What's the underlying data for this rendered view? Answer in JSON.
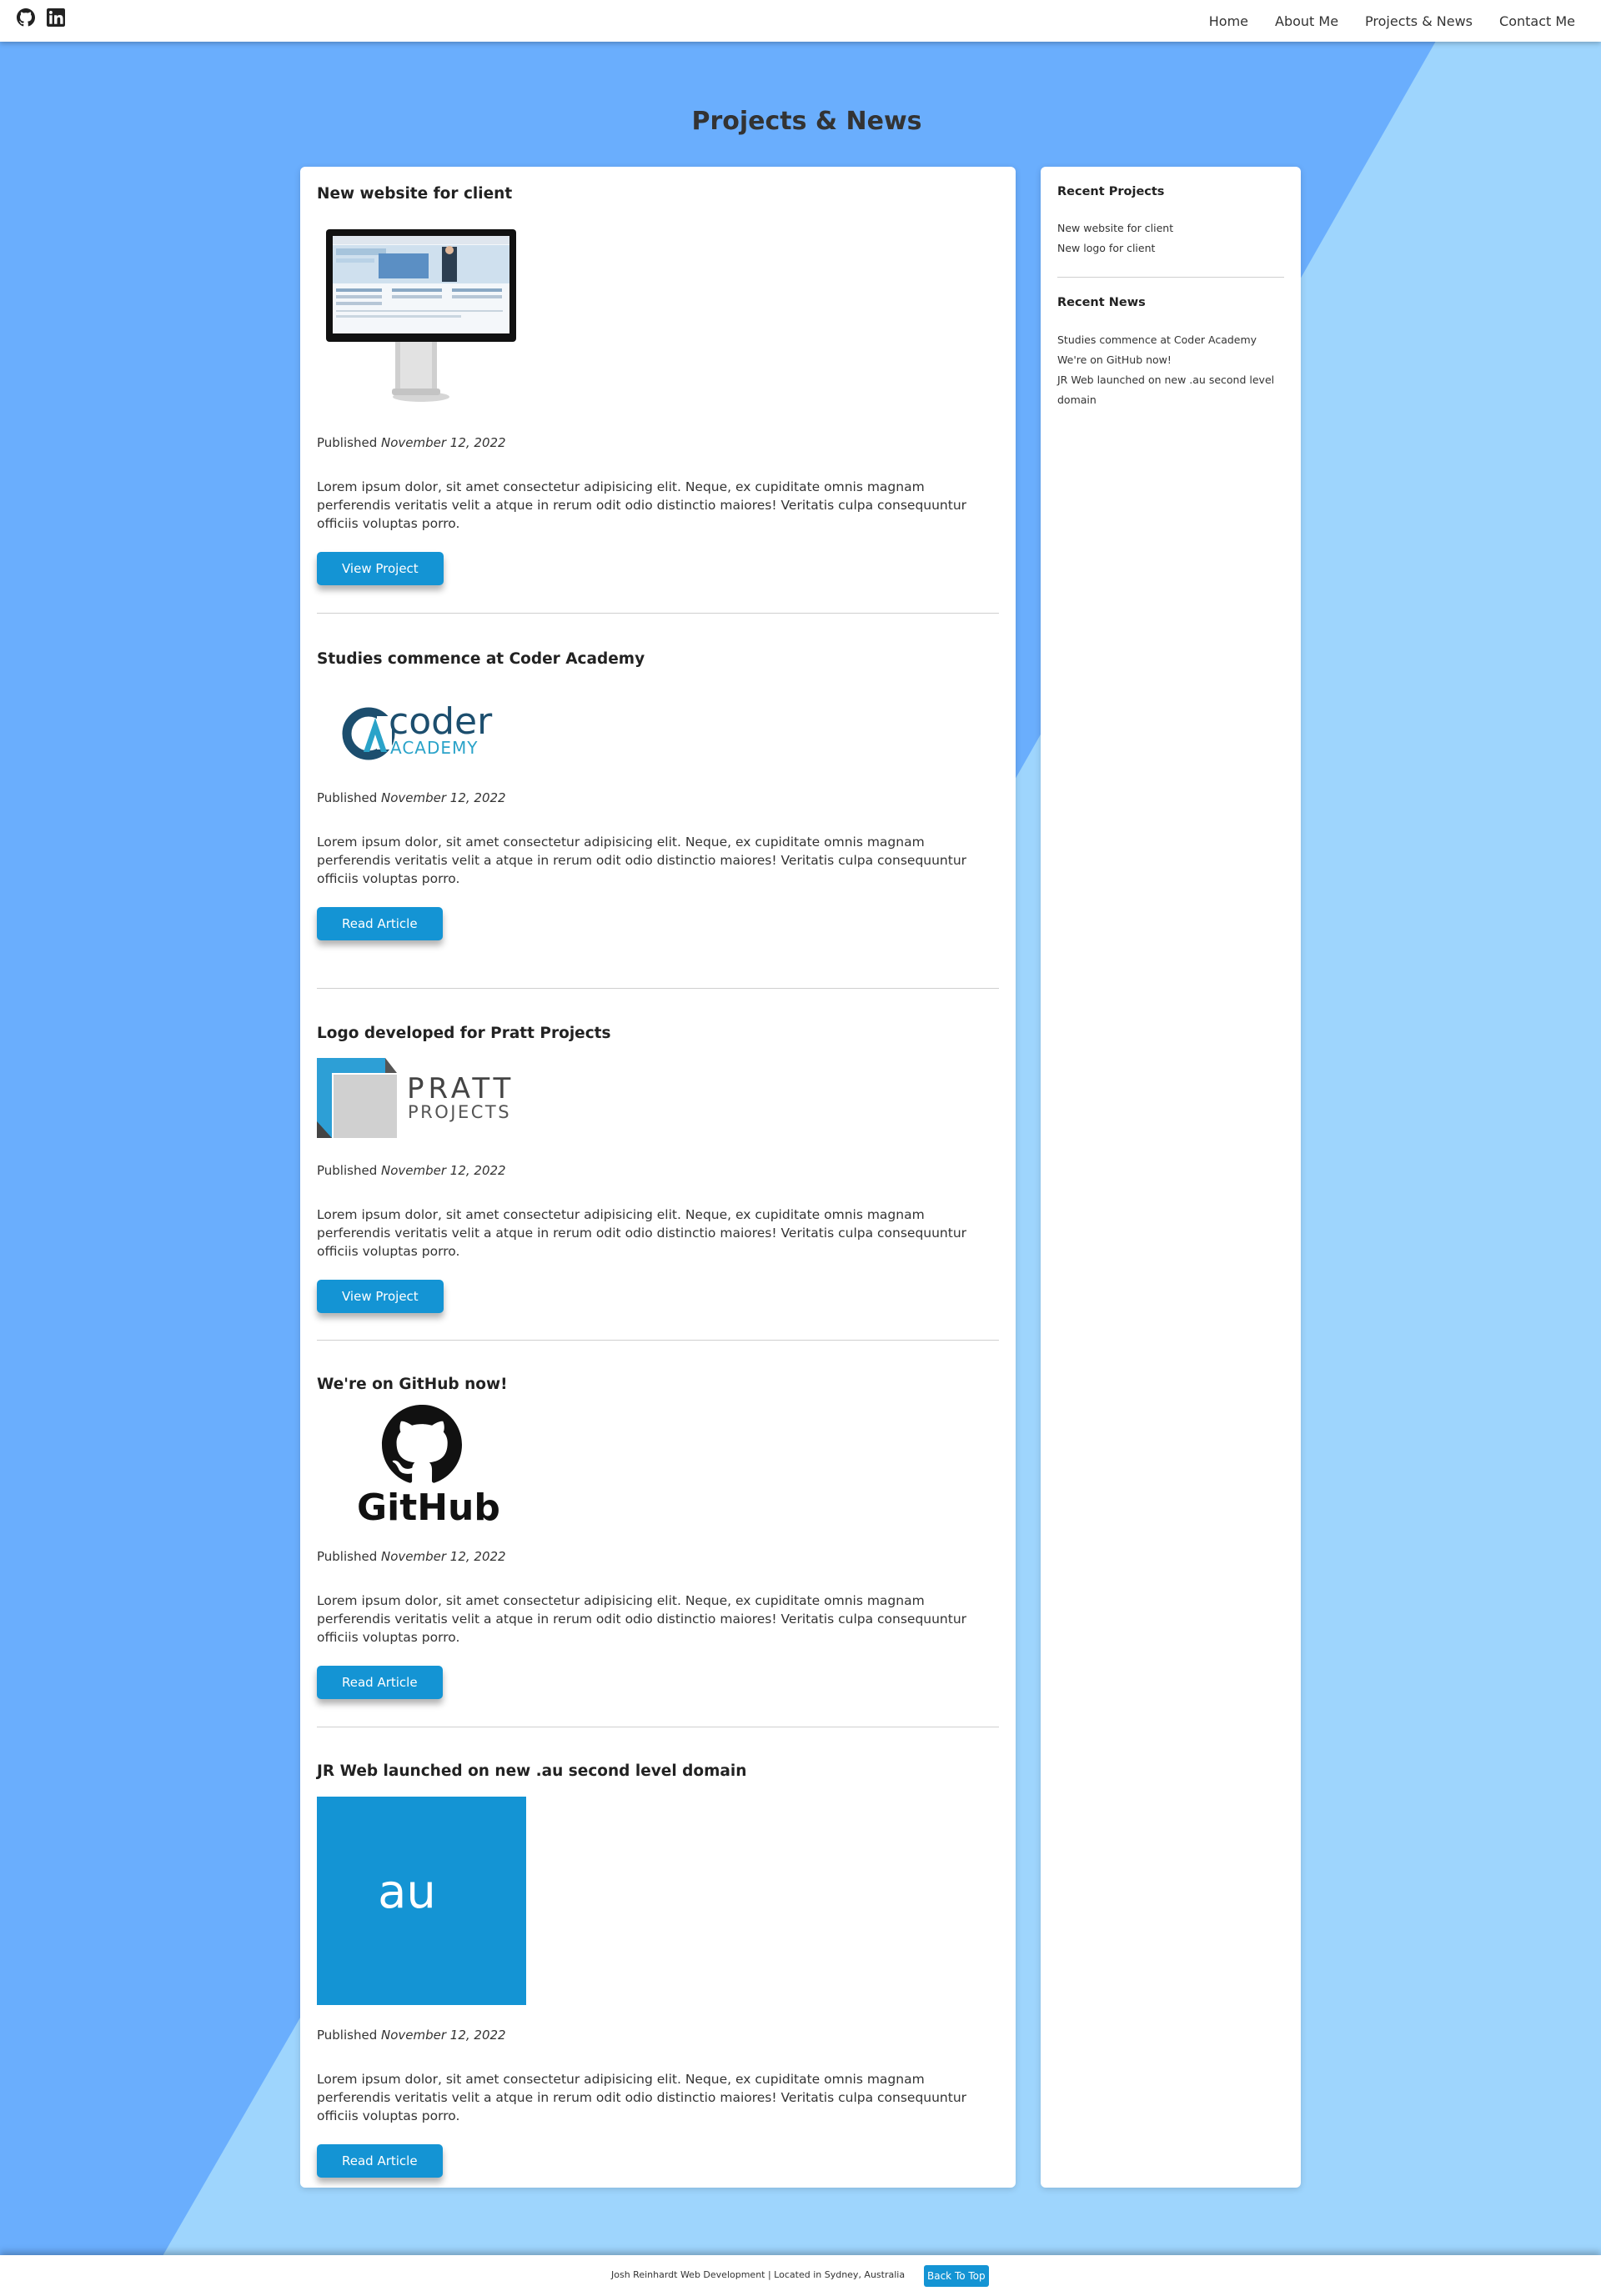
{
  "nav": {
    "links": [
      "Home",
      "About Me",
      "Projects & News",
      "Contact Me"
    ]
  },
  "page": {
    "title": "Projects & News"
  },
  "posts": [
    {
      "title": "New website for client",
      "published_label": "Published",
      "date": "November 12, 2022",
      "excerpt": "Lorem ipsum dolor, sit amet consectetur adipisicing elit. Neque, ex cupiditate omnis magnam perferendis veritatis velit a atque in rerum odit odio distinctio maiores! Veritatis culpa consequuntur officiis voluptas porro.",
      "button": "View Project"
    },
    {
      "title": "Studies commence at Coder Academy",
      "published_label": "Published",
      "date": "November 12, 2022",
      "excerpt": "Lorem ipsum dolor, sit amet consectetur adipisicing elit. Neque, ex cupiditate omnis magnam perferendis veritatis velit a atque in rerum odit odio distinctio maiores! Veritatis culpa consequuntur officiis voluptas porro.",
      "button": "Read Article",
      "logo": {
        "line1": "coder",
        "line2": "ACADEMY"
      }
    },
    {
      "title": "Logo developed for Pratt Projects",
      "published_label": "Published",
      "date": "November 12, 2022",
      "excerpt": "Lorem ipsum dolor, sit amet consectetur adipisicing elit. Neque, ex cupiditate omnis magnam perferendis veritatis velit a atque in rerum odit odio distinctio maiores! Veritatis culpa consequuntur officiis voluptas porro.",
      "button": "View Project",
      "logo": {
        "line1": "PRATT",
        "line2": "PROJECTS"
      }
    },
    {
      "title": "We're on GitHub now!",
      "published_label": "Published",
      "date": "November 12, 2022",
      "excerpt": "Lorem ipsum dolor, sit amet consectetur adipisicing elit. Neque, ex cupiditate omnis magnam perferendis veritatis velit a atque in rerum odit odio distinctio maiores! Veritatis culpa consequuntur officiis voluptas porro.",
      "button": "Read Article",
      "logo": {
        "line1": "GitHub"
      }
    },
    {
      "title": "JR Web launched on new .au second level domain",
      "published_label": "Published",
      "date": "November 12, 2022",
      "excerpt": "Lorem ipsum dolor, sit amet consectetur adipisicing elit. Neque, ex cupiditate omnis magnam perferendis veritatis velit a atque in rerum odit odio distinctio maiores! Veritatis culpa consequuntur officiis voluptas porro.",
      "button": "Read Article",
      "logo": {
        "line1": "au"
      }
    }
  ],
  "sidebar": {
    "recent_projects_title": "Recent Projects",
    "recent_projects": [
      "New website for client",
      "New logo for client"
    ],
    "recent_news_title": "Recent News",
    "recent_news": [
      "Studies commence at Coder Academy",
      "We're on GitHub now!",
      "JR Web launched on new .au second level domain"
    ]
  },
  "footer": {
    "text": "Josh Reinhardt Web Development | Located in Sydney, Australia",
    "back_to_top": "Back To Top"
  },
  "colors": {
    "accent": "#1494d4",
    "bg_dark": "#6aaefd",
    "bg_light": "#9ed5fd"
  }
}
